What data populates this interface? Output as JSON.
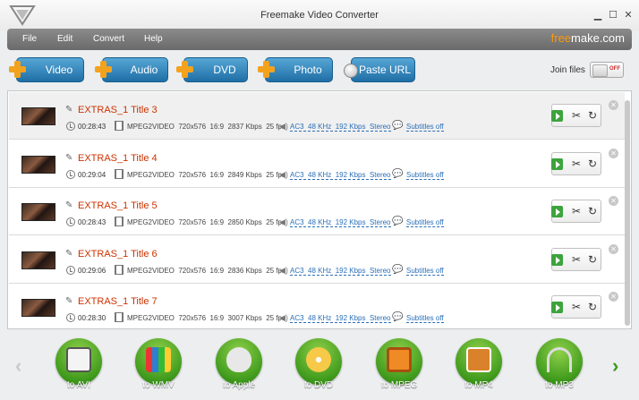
{
  "window": {
    "title": "Freemake Video Converter",
    "controls": [
      "▁",
      "☐",
      "✕"
    ]
  },
  "menu": [
    "File",
    "Edit",
    "Convert",
    "Help"
  ],
  "brand": {
    "part1": "free",
    "part2": "make.com"
  },
  "toolbar": {
    "add_video": "Video",
    "add_audio": "Audio",
    "add_dvd": "DVD",
    "add_photo": "Photo",
    "paste_url": "Paste URL",
    "join_label": "Join files",
    "join_toggle": "OFF"
  },
  "rows": [
    {
      "title": "EXTRAS_1 Title 3",
      "duration": "00:28:43",
      "video": "MPEG2VIDEO  720x576  16:9  2837 Kbps  25 fps",
      "audio": "AC3  48 KHz  192 Kbps  Stereo",
      "subtitles": "Subtitles off"
    },
    {
      "title": "EXTRAS_1 Title 4",
      "duration": "00:29:04",
      "video": "MPEG2VIDEO  720x576  16:9  2849 Kbps  25 fps",
      "audio": "AC3  48 KHz  192 Kbps  Stereo",
      "subtitles": "Subtitles off"
    },
    {
      "title": "EXTRAS_1 Title 5",
      "duration": "00:28:43",
      "video": "MPEG2VIDEO  720x576  16:9  2850 Kbps  25 fps",
      "audio": "AC3  48 KHz  192 Kbps  Stereo",
      "subtitles": "Subtitles off"
    },
    {
      "title": "EXTRAS_1 Title 6",
      "duration": "00:29:06",
      "video": "MPEG2VIDEO  720x576  16:9  2836 Kbps  25 fps",
      "audio": "AC3  48 KHz  192 Kbps  Stereo",
      "subtitles": "Subtitles off"
    },
    {
      "title": "EXTRAS_1 Title 7",
      "duration": "00:28:30",
      "video": "MPEG2VIDEO  720x576  16:9  3007 Kbps  25 fps",
      "audio": "AC3  48 KHz  192 Kbps  Stereo",
      "subtitles": "Subtitles off"
    }
  ],
  "footer": {
    "prev": "‹",
    "next": "›",
    "formats": [
      {
        "label": "to AVI",
        "icon": "avi-film-icon",
        "color": "#f4f4f4"
      },
      {
        "label": "to WMV",
        "icon": "wmv-windows-icon",
        "color": "#2f7fd0"
      },
      {
        "label": "to Apple",
        "icon": "apple-icon",
        "color": "#e8e8e8"
      },
      {
        "label": "to DVD",
        "icon": "dvd-disc-icon",
        "color": "#f7c948"
      },
      {
        "label": "to MPEG",
        "icon": "mpeg-tv-icon",
        "color": "#f08a24"
      },
      {
        "label": "to MP4",
        "icon": "mp4-photos-icon",
        "color": "#d9822b"
      },
      {
        "label": "to MP3",
        "icon": "mp3-headphones-icon",
        "color": "#dcdcdc"
      }
    ]
  },
  "colors": {
    "accent_green": "#3f9a1c",
    "button_blue": "#1f6fa6",
    "title_red": "#cc3300",
    "link_blue": "#2a6fb8"
  }
}
